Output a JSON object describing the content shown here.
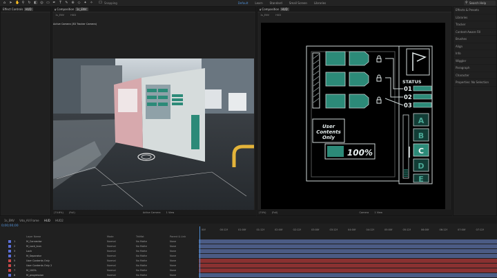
{
  "toolbar": {
    "snapping_label": "Snapping",
    "workspaces": [
      "Default",
      "Learn",
      "Standard",
      "Small Screen",
      "Libraries"
    ],
    "search_label": "Search Help"
  },
  "left_panel": {
    "tab_label": "Effect Controls",
    "tab_value": "HUD"
  },
  "viewer": {
    "tab_label": "Composition",
    "tab_value": "1s_ENV",
    "subtabs": [
      "1s_ENV",
      "HUD"
    ],
    "camera_label": "Active Camera (3D Tracker Camera)",
    "bar_items": [
      "(74.6%)",
      "(Full)",
      "Active Camera",
      "1 View"
    ]
  },
  "comp": {
    "tab_label": "Composition",
    "tab_value": "HUD",
    "subtabs": [
      "1s_ENV",
      "HUD"
    ],
    "bar_items": [
      "(74%)",
      "(Full)",
      "Camera",
      "1 View"
    ]
  },
  "hud": {
    "status_label": "STATUS",
    "status_numbers": [
      "01",
      "02",
      "03"
    ],
    "letters": [
      "A",
      "B",
      "C",
      "D",
      "E"
    ],
    "user_text": [
      "User",
      "Contents",
      "Only"
    ],
    "percent": "100%",
    "percent_value": 100
  },
  "side_panel": {
    "items": [
      "Effects & Presets",
      "Libraries",
      "Tracker",
      "Content-Aware Fill",
      "Brushes",
      "Align",
      "Info",
      "Wiggler",
      "Paragraph",
      "Character",
      "Properties: No Selection"
    ]
  },
  "timeline": {
    "tabs": [
      "1s_ENV",
      "Vdo_All Frame",
      "HUD",
      "HUD2"
    ],
    "active_tab": "HUD",
    "timecode": "0;00;00;00",
    "columns": {
      "name": "Layer Name",
      "mode": "Mode",
      "trkmat": "TrkMat",
      "parent": "Parent & Link"
    },
    "ruler": [
      "00f",
      "00:12f",
      "01:00f",
      "01:12f",
      "02:00f",
      "02:12f",
      "03:00f",
      "03:12f",
      "04:00f",
      "04:12f",
      "05:00f",
      "05:12f",
      "06:00f",
      "06:12f",
      "07:00f",
      "07:12f"
    ],
    "layers": [
      {
        "num": "1",
        "name": "M_Connector",
        "mode": "Normal",
        "trkmat": "No Matte",
        "parent": "None",
        "color": "#5b6fd8"
      },
      {
        "num": "2",
        "name": "M_Lock_Icon",
        "mode": "Normal",
        "trkmat": "No Matte",
        "parent": "None",
        "color": "#5b6fd8"
      },
      {
        "num": "3",
        "name": "Lock",
        "mode": "Normal",
        "trkmat": "No Matte",
        "parent": "None",
        "color": "#5b6fd8"
      },
      {
        "num": "4",
        "name": "M_Separator",
        "mode": "Normal",
        "trkmat": "No Matte",
        "parent": "None",
        "color": "#5b6fd8"
      },
      {
        "num": "5",
        "name": "User Contents Only",
        "mode": "Normal",
        "trkmat": "No Matte",
        "parent": "None",
        "color": "#c94848"
      },
      {
        "num": "6",
        "name": "User Contents Only 2",
        "mode": "Normal",
        "trkmat": "No Matte",
        "parent": "None",
        "color": "#c94848"
      },
      {
        "num": "7",
        "name": "M_100%",
        "mode": "Normal",
        "trkmat": "No Matte",
        "parent": "None",
        "color": "#c94848"
      },
      {
        "num": "8",
        "name": "M_progression",
        "mode": "Normal",
        "trkmat": "No Matte",
        "parent": "None",
        "color": "#5b6fd8"
      }
    ]
  },
  "colors": {
    "accent": "#4f8fd6",
    "hud_teal": "#2c8a78",
    "hud_line": "#cfd8d8",
    "bar_blue": "#4b5b84",
    "bar_red": "#8a3131"
  }
}
